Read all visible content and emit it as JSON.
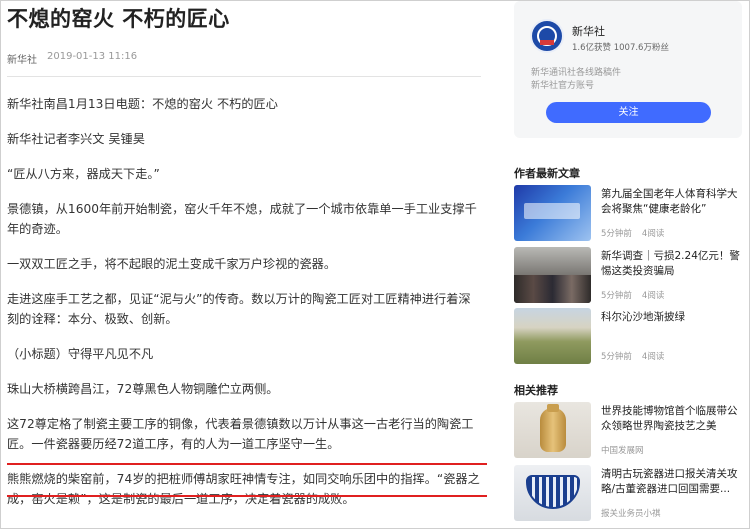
{
  "article": {
    "title": "不熄的窑火 不朽的匠心",
    "source": "新华社",
    "date": "2019-01-13 11:16",
    "paragraphs": [
      "新华社南昌1月13日电题：不熄的窑火 不朽的匠心",
      "新华社记者李兴文 吴锺昊",
      "“匠从八方来，器成天下走。”",
      "景德镇，从1600年前开始制瓷，窑火千年不熄，成就了一个城市依靠单一手工业支撑千年的奇迹。",
      "一双双工匠之手，将不起眼的泥土变成千家万户珍视的瓷器。",
      "走进这座手工艺之都，见证“泥与火”的传奇。数以万计的陶瓷工匠对工匠精神进行着深刻的诠释：本分、极致、创新。",
      "（小标题）守得平凡见不凡",
      "珠山大桥横跨昌江，72尊黑色人物铜雕伫立两侧。",
      "这72尊定格了制瓷主要工序的铜像，代表着景德镇数以万计从事这一古老行当的陶瓷工匠。一件瓷器要历经72道工序，有的人为一道工序坚守一生。",
      "熊熊燃烧的柴窑前，74岁的把桩师傅胡家旺神情专注，如同交响乐团中的指挥。“瓷器之成，窑火是赖”，这是制瓷的最后一道工序，决定着瓷器的成败。"
    ]
  },
  "author": {
    "name": "新华社",
    "stats": "1.6亿获赞 1007.6万粉丝",
    "desc_line1": "新华通讯社各线路稿件",
    "desc_line2": "新华社官方账号",
    "follow_label": "关注"
  },
  "latest": {
    "heading": "作者最新文章",
    "items": [
      {
        "title": "第九届全国老年人体育科学大会将聚焦“健康老龄化”",
        "time": "5分钟前",
        "reads": "4阅读"
      },
      {
        "title": "新华调查｜亏损2.24亿元！警惕这类投资骗局",
        "time": "5分钟前",
        "reads": "4阅读"
      },
      {
        "title": "科尔沁沙地渐披绿",
        "time": "5分钟前",
        "reads": "4阅读"
      }
    ]
  },
  "related": {
    "heading": "相关推荐",
    "items": [
      {
        "title": "世界技能博物馆首个临展带公众领略世界陶瓷技艺之美",
        "source": "中国发展网"
      },
      {
        "title": "清明古玩瓷器进口报关清关攻略/古董瓷器进口回国需要...",
        "source": "报关业务员小祺"
      }
    ]
  }
}
